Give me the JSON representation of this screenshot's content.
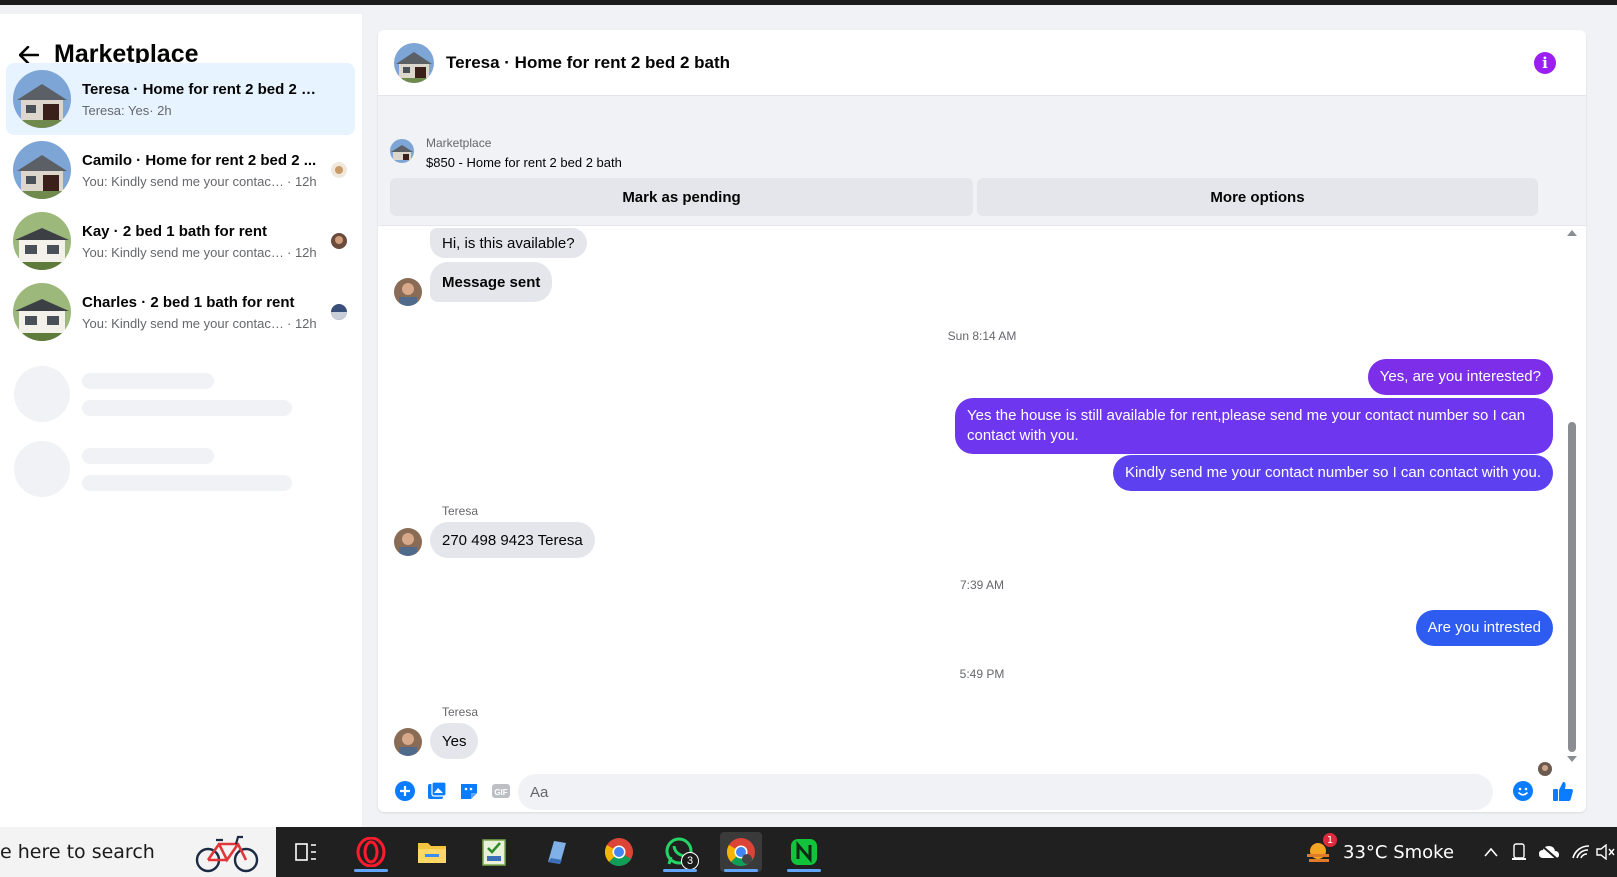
{
  "sidebar": {
    "title": "Marketplace",
    "conversations": [
      {
        "title": "Teresa · Home for rent 2 bed 2 bath",
        "snippet": "Teresa: Yes",
        "time": "· 2h",
        "active": true
      },
      {
        "title": "Camilo · Home for rent 2 bed 2 ...",
        "snippet": "You: Kindly send me your contact ...",
        "time": "· 12h"
      },
      {
        "title": "Kay · 2 bed 1 bath for rent",
        "snippet": "You: Kindly send me your contact ...",
        "time": "· 12h"
      },
      {
        "title": "Charles · 2 bed 1 bath for rent",
        "snippet": "You: Kindly send me your contact ...",
        "time": "· 12h"
      }
    ]
  },
  "chat": {
    "title": "Teresa · Home for rent 2 bed 2 bath",
    "listing": {
      "label": "Marketplace",
      "price_title": "$850 - Home for rent 2 bed 2 bath",
      "btn_pending": "Mark as pending",
      "btn_more": "More options"
    },
    "messages": {
      "m1": "Hi, is this available?",
      "m2": "Message sent",
      "ts1": "Sun 8:14 AM",
      "m3": "Yes, are you interested?",
      "m4": "Yes the house is still available for rent,please send me your contact number so I can contact with you.",
      "m5": "Kindly send me your contact number so I can contact with you.",
      "sender1": "Teresa",
      "m6": "270 498 9423 Teresa",
      "ts2": "7:39 AM",
      "m7": "Are you intrested",
      "ts3": "5:49 PM",
      "sender2": "Teresa",
      "m8": "Yes"
    },
    "composer": {
      "placeholder": "Aa"
    }
  },
  "taskbar": {
    "search_text": "e here to search",
    "whatsapp_badge": "3",
    "weather_badge": "1",
    "weather": "33°C  Smoke"
  },
  "colors": {
    "accent_purple": "#9b1ff2",
    "out_bubble_purple": "#7c2ee8",
    "out_bubble_blue": "#2e5cf0",
    "active_item": "#e7f3ff"
  }
}
